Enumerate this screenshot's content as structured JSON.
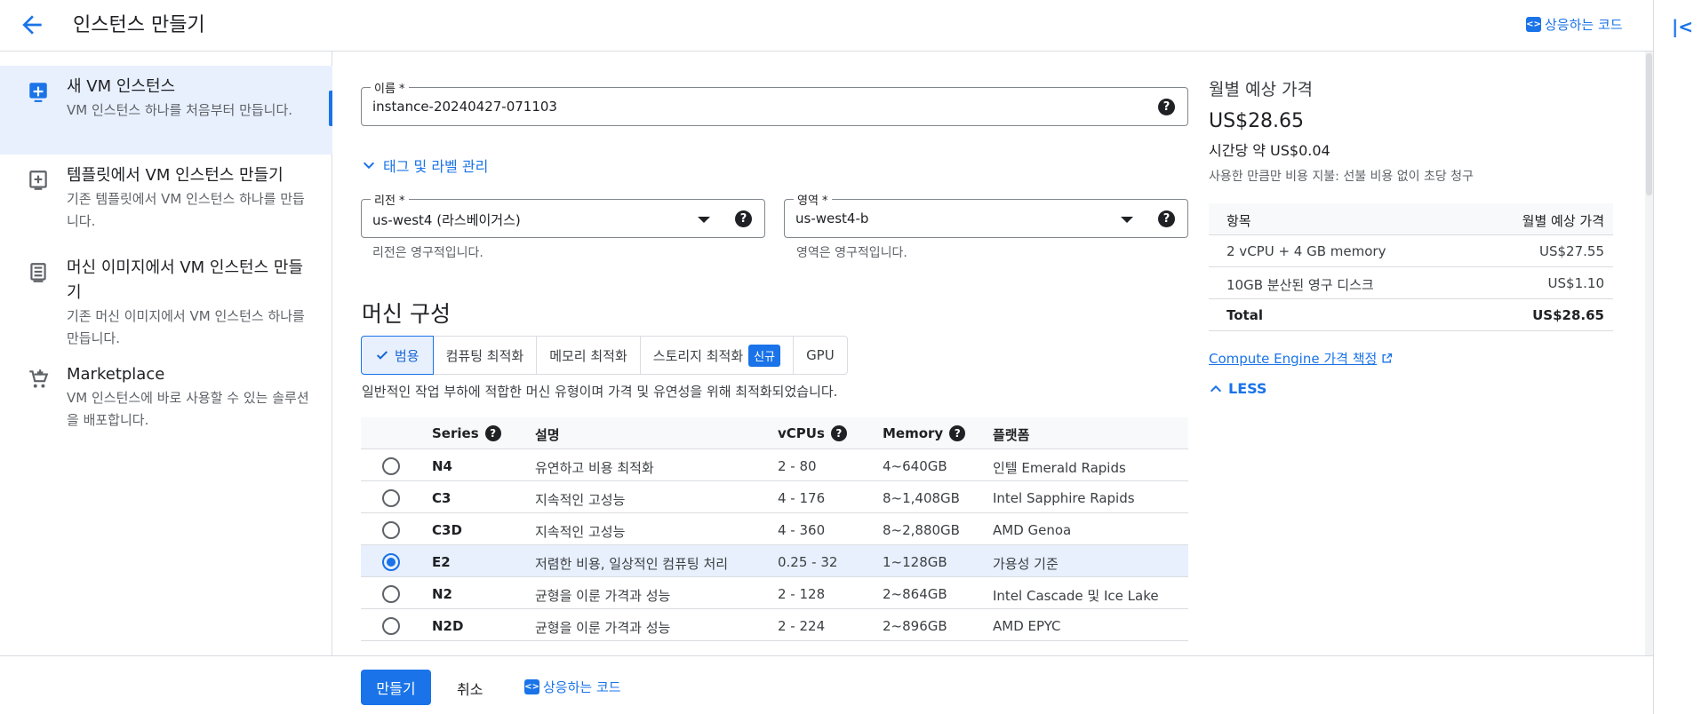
{
  "header": {
    "title": "인스턴스 만들기",
    "code_label": "상응하는 코드"
  },
  "sidebar": {
    "items": [
      {
        "title": "새 VM 인스턴스",
        "desc": "VM 인스턴스 하나를 처음부터 만듭니다."
      },
      {
        "title": "템플릿에서 VM 인스턴스 만들기",
        "desc": "기존 템플릿에서 VM 인스턴스 하나를 만듭니다."
      },
      {
        "title": "머신 이미지에서 VM 인스턴스 만들기",
        "desc": "기존 머신 이미지에서 VM 인스턴스 하나를 만듭니다."
      },
      {
        "title": "Marketplace",
        "desc": "VM 인스턴스에 바로 사용할 수 있는 솔루션을 배포합니다."
      }
    ]
  },
  "form": {
    "name_label": "이름 *",
    "name_value": "instance-20240427-071103",
    "tags_link": "태그 및 라벨 관리",
    "region_label": "리전 *",
    "region_value": "us-west4 (라스베이거스)",
    "region_hint": "리전은 영구적입니다.",
    "zone_label": "영역 *",
    "zone_value": "us-west4-b",
    "zone_hint": "영역은 영구적입니다.",
    "help_glyph": "?"
  },
  "machine": {
    "section_title": "머신 구성",
    "tabs": [
      "범용",
      "컴퓨팅 최적화",
      "메모리 최적화",
      "스토리지 최적화",
      "GPU"
    ],
    "new_badge": "신규",
    "tab_desc": "일반적인 작업 부하에 적합한 머신 유형이며 가격 및 유연성을 위해 최적화되었습니다.",
    "columns": {
      "series": "Series",
      "desc": "설명",
      "vcpus": "vCPUs",
      "memory": "Memory",
      "platform": "플랫폼"
    },
    "rows": [
      {
        "series": "N4",
        "desc": "유연하고 비용 최적화",
        "vcpus": "2 - 80",
        "memory": "4~640GB",
        "platform": "인텔 Emerald Rapids",
        "selected": false
      },
      {
        "series": "C3",
        "desc": "지속적인 고성능",
        "vcpus": "4 - 176",
        "memory": "8~1,408GB",
        "platform": "Intel Sapphire Rapids",
        "selected": false
      },
      {
        "series": "C3D",
        "desc": "지속적인 고성능",
        "vcpus": "4 - 360",
        "memory": "8~2,880GB",
        "platform": "AMD Genoa",
        "selected": false
      },
      {
        "series": "E2",
        "desc": "저렴한 비용, 일상적인 컴퓨팅 처리",
        "vcpus": "0.25 - 32",
        "memory": "1~128GB",
        "platform": "가용성 기준",
        "selected": true
      },
      {
        "series": "N2",
        "desc": "균형을 이룬 가격과 성능",
        "vcpus": "2 - 128",
        "memory": "2~864GB",
        "platform": "Intel Cascade 및 Ice Lake",
        "selected": false
      },
      {
        "series": "N2D",
        "desc": "균형을 이룬 가격과 성능",
        "vcpus": "2 - 224",
        "memory": "2~896GB",
        "platform": "AMD EPYC",
        "selected": false
      }
    ]
  },
  "estimate": {
    "title": "월별 예상 가격",
    "price": "US$28.65",
    "hourly": "시간당 약 US$0.04",
    "note": "사용한 만큼만 비용 지불: 선불 비용 없이 초당 청구",
    "col_item": "항목",
    "col_price": "월별 예상 가격",
    "rows": [
      {
        "item": "2 vCPU + 4 GB memory",
        "price": "US$27.55"
      },
      {
        "item": "10GB 분산된 영구 디스크",
        "price": "US$1.10"
      }
    ],
    "total_label": "Total",
    "total_price": "US$28.65",
    "pricing_link": "Compute Engine 가격 책정",
    "less_label": "LESS"
  },
  "footer": {
    "create": "만들기",
    "cancel": "취소",
    "code": "상응하는 코드"
  }
}
